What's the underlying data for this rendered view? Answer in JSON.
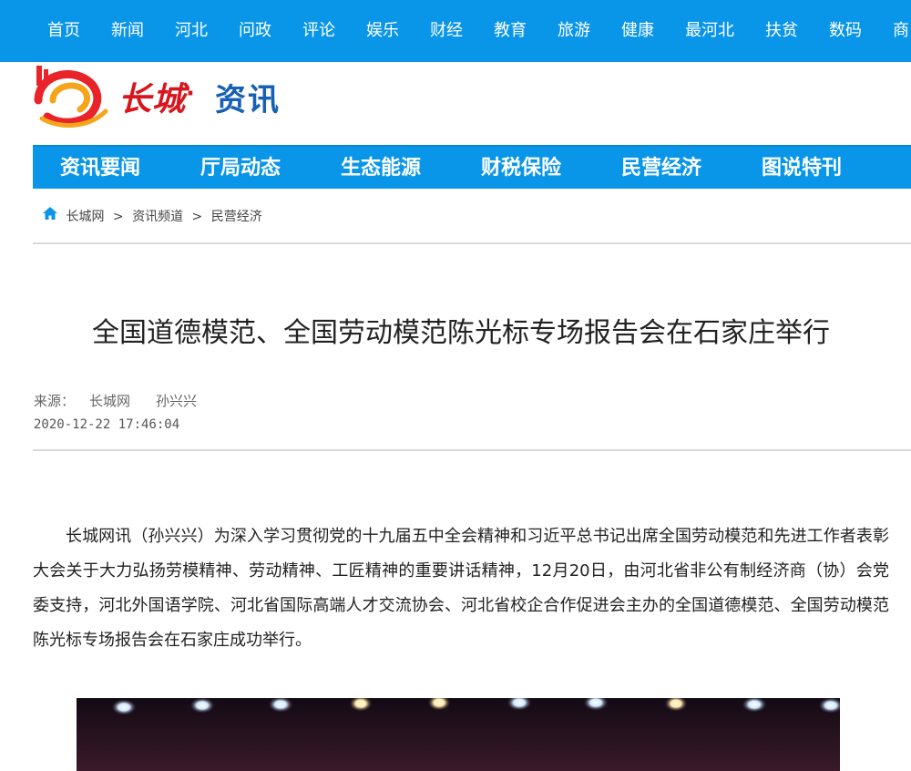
{
  "top_nav": [
    "首页",
    "新闻",
    "河北",
    "问政",
    "评论",
    "娱乐",
    "财经",
    "教育",
    "旅游",
    "健康",
    "最河北",
    "扶贫",
    "数码",
    "商"
  ],
  "logo": {
    "brand": "长城",
    "dot": "·",
    "channel": "资讯"
  },
  "channel_nav": [
    "资讯要闻",
    "厅局动态",
    "生态能源",
    "财税保险",
    "民营经济",
    "图说特刊"
  ],
  "breadcrumb": [
    "长城网",
    "资讯频道",
    "民营经济"
  ],
  "breadcrumb_sep": ">",
  "article": {
    "title": "全国道德模范、全国劳动模范陈光标专场报告会在石家庄举行",
    "source_label": "来源：",
    "source": "长城网",
    "author": "孙兴兴",
    "datetime": "2020-12-22 17:46:04",
    "body": "长城网讯（孙兴兴）为深入学习贯彻党的十九届五中全会精神和习近平总书记出席全国劳动模范和先进工作者表彰大会关于大力弘扬劳模精神、劳动精神、工匠精神的重要讲话精神，12月20日，由河北省非公有制经济商（协）会党委支持，河北外国语学院、河北省国际高端人才交流协会、河北省校企合作促进会主办的全国道德模范、全国劳动模范陈光标专场报告会在石家庄成功举行。"
  },
  "colors": {
    "nav_blue": "#0a96e8",
    "brand_red": "#d8141c",
    "zixun_blue": "#1760b4"
  },
  "icons": {
    "home": "home-icon"
  }
}
